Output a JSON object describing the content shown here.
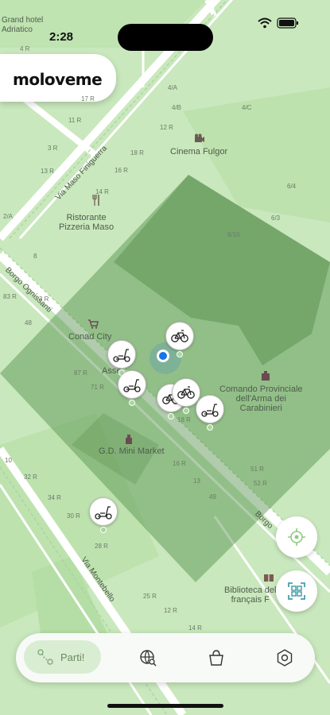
{
  "status_bar": {
    "time": "2:28"
  },
  "app": {
    "logo_text": "moloveme"
  },
  "map": {
    "pois": [
      {
        "label": "Grand hotel\nAdriatico"
      },
      {
        "label": "Cinema Fulgor"
      },
      {
        "label": "Ristorante\nPizzeria Maso"
      },
      {
        "label": "Conad City"
      },
      {
        "label": "Comando Provinciale\ndell'Arma dei\nCarabinieri"
      },
      {
        "label": "G.D. Mini Market"
      },
      {
        "label": "Biblioteca del\nfrançais F"
      },
      {
        "label": "Asse"
      }
    ],
    "streets": [
      {
        "name": "Via Maso Finiguerra"
      },
      {
        "name": "Borgo Ognissanti"
      },
      {
        "name": "Via Montebello"
      },
      {
        "name": "Borgo"
      }
    ],
    "house_numbers": [
      "4 R",
      "3 R",
      "11 R",
      "13 R",
      "17 R",
      "18 R",
      "16 R",
      "14 R",
      "12 R",
      "4/A",
      "4/B",
      "4/C",
      "6/4",
      "6/3",
      "6/10",
      "8",
      "2/A",
      "3 R",
      "48",
      "83 R",
      "87 R",
      "71 R",
      "10",
      "32 R",
      "34 R",
      "30 R",
      "28 R",
      "25 R",
      "12 R",
      "14 R",
      "18 R",
      "16 R",
      "13",
      "49",
      "52 R",
      "51 R",
      "50",
      "45"
    ]
  },
  "vehicles": [
    {
      "type": "bicycle"
    },
    {
      "type": "scooter"
    },
    {
      "type": "scooter"
    },
    {
      "type": "bicycle"
    },
    {
      "type": "bicycle"
    },
    {
      "type": "scooter"
    },
    {
      "type": "scooter"
    }
  ],
  "controls": {
    "locate_icon": "crosshair-icon",
    "scan_icon": "qr-scan-icon"
  },
  "nav": {
    "primary_label": "Parti!",
    "items": [
      {
        "icon": "route-icon"
      },
      {
        "icon": "globe-search-icon"
      },
      {
        "icon": "bag-icon"
      },
      {
        "icon": "settings-icon"
      }
    ]
  },
  "colors": {
    "map_bg": "#c9e8bd",
    "zone": "#6aa55e",
    "accent": "#8ecb80",
    "user": "#1a73e8"
  }
}
